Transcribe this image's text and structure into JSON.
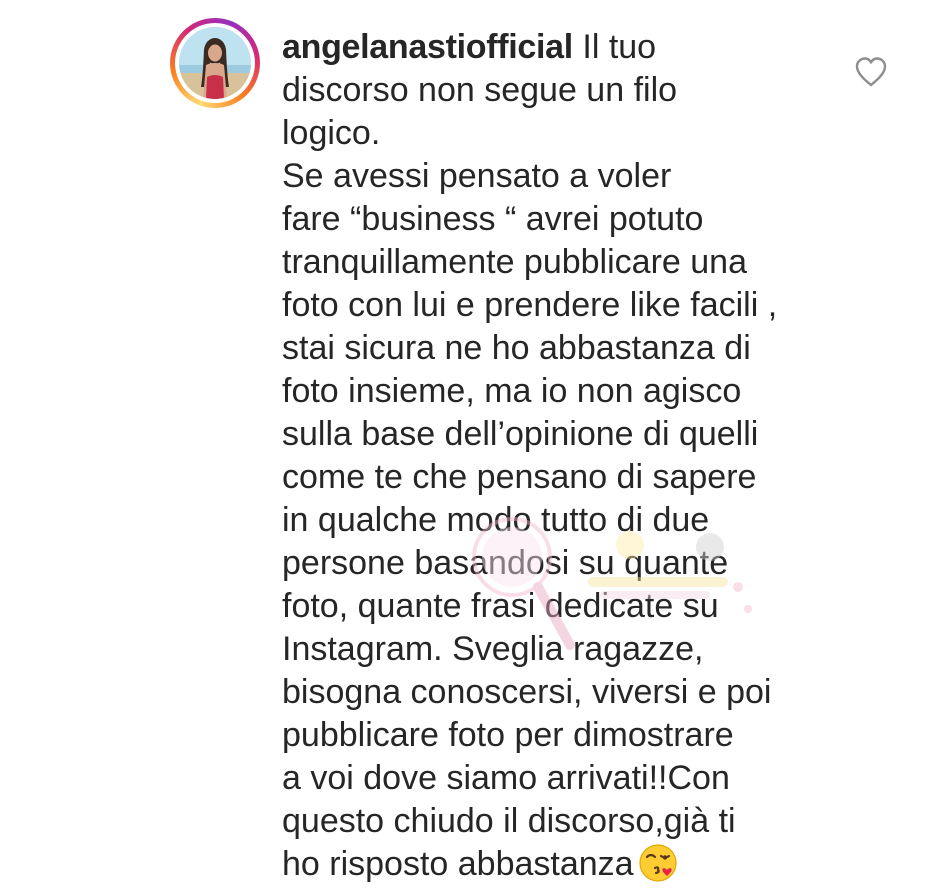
{
  "comment": {
    "username": "angelanastiofficial",
    "body": " Il tuo\ndiscorso non segue un filo\nlogico.\nSe avessi pensato a voler\nfare “business “ avrei potuto\ntranquillamente pubblicare una\nfoto con lui e prendere like facili ,\nstai sicura ne ho abbastanza di\nfoto insieme,  ma io non agisco\nsulla base dell’opinione di quelli\ncome te che pensano di sapere\nin qualche modo tutto di due\npersone basandosi su quante\nfoto, quante frasi dedicate su\nInstagram. Sveglia ragazze,\nbisogna conoscersi, viversi e poi\npubblicare foto per dimostrare\na voi dove siamo arrivati!!Con\nquesto chiudo il discorso,già ti\nho risposto abbastanza",
    "emoji_icon": "face-blowing-kiss-emoji"
  },
  "avatar": {
    "icon": "profile-photo",
    "story_ring_colors": [
      "#feda75",
      "#fa7e1e",
      "#d62976",
      "#962fbf"
    ]
  },
  "like": {
    "icon": "heart-outline-icon",
    "color": "#8e8e8e"
  },
  "watermark": {
    "icon": "watermark-logo"
  }
}
